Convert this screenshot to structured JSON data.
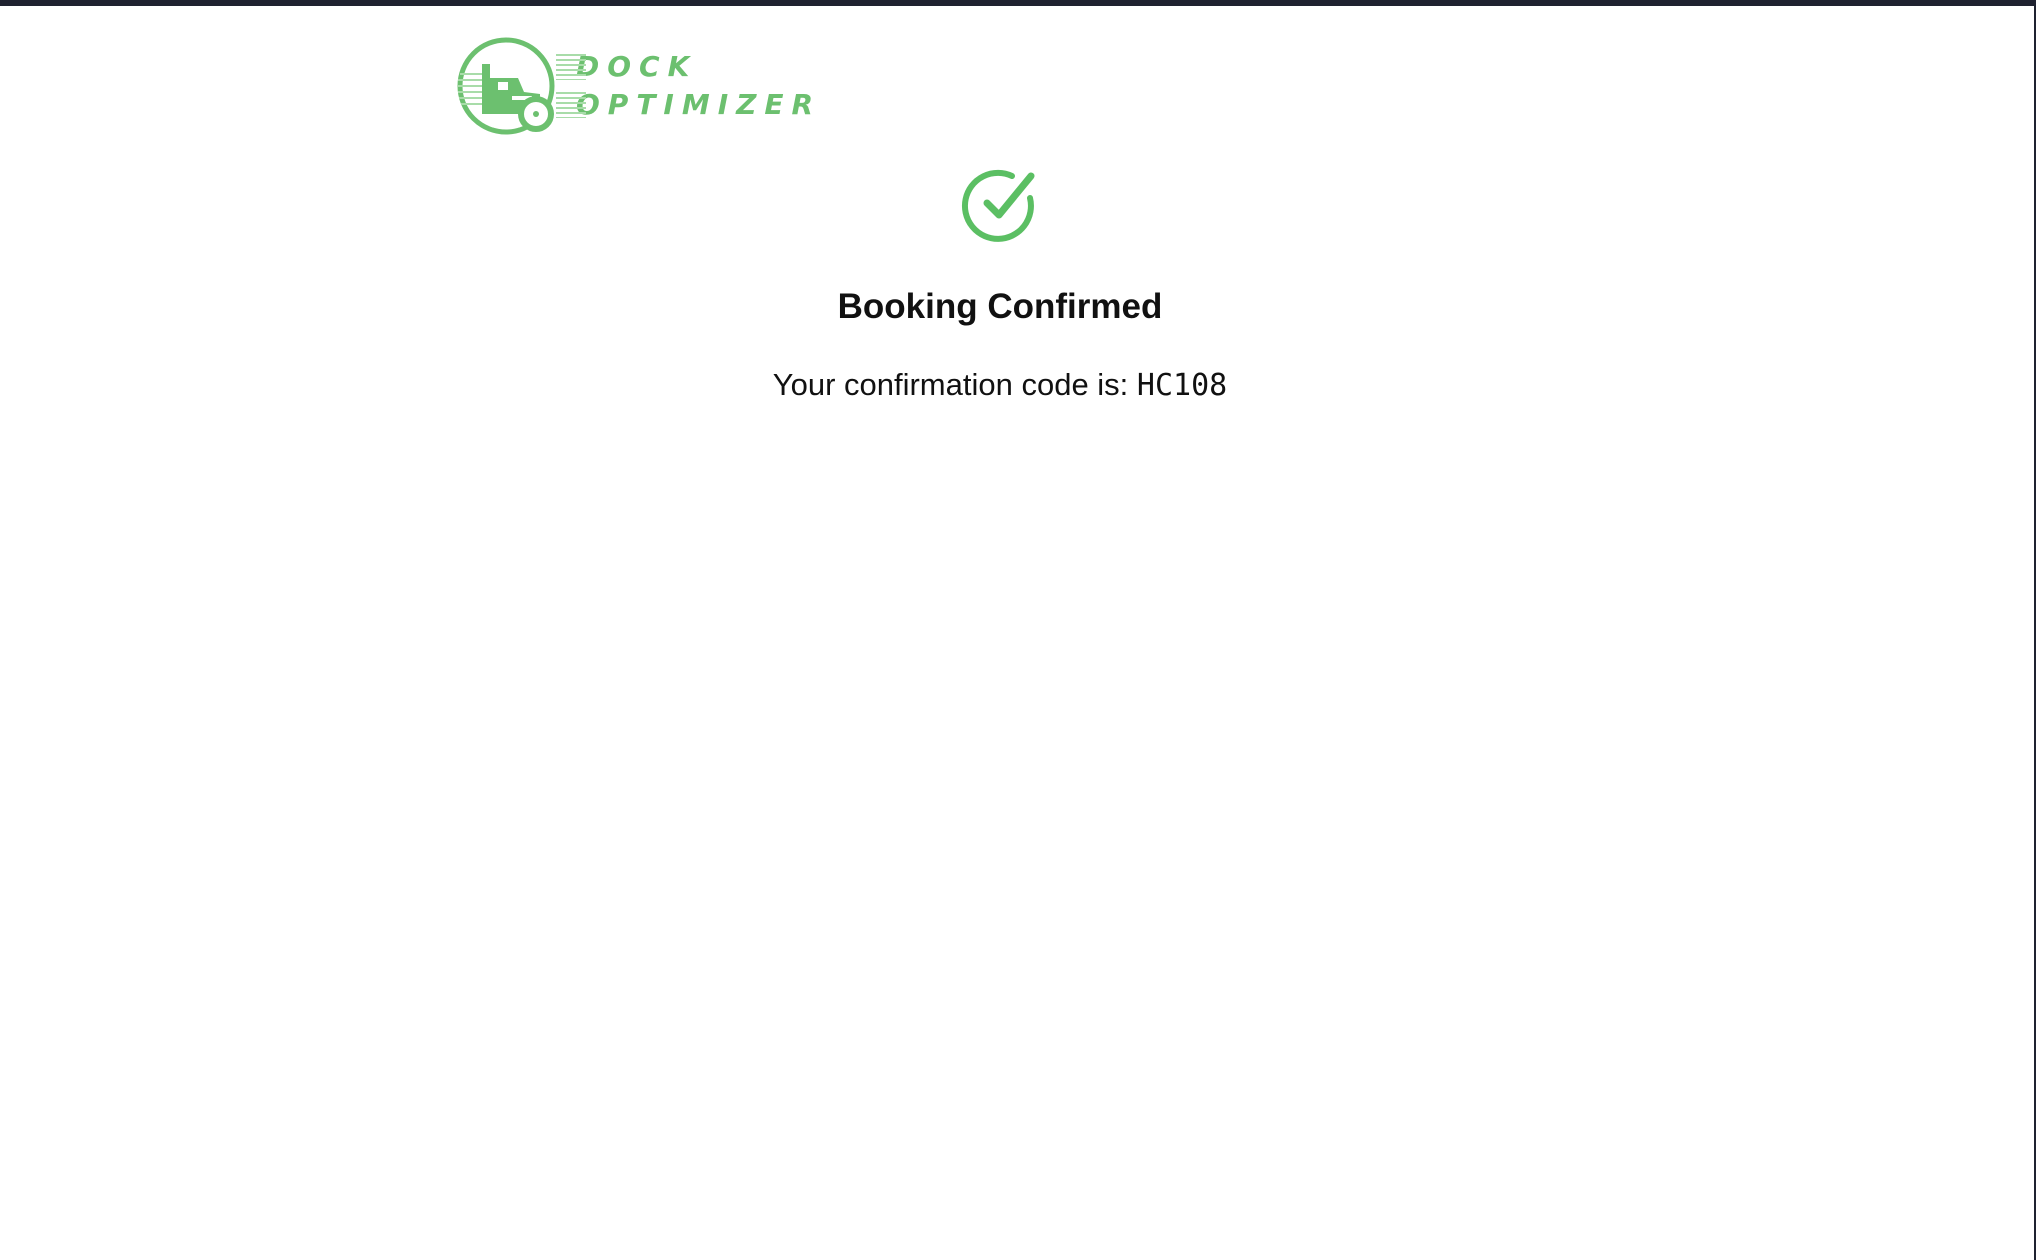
{
  "brand": {
    "logo_line1": "DOCK",
    "logo_line2": "OPTIMIZER",
    "color": "#6cc06f"
  },
  "confirmation": {
    "icon": "check-circle-icon",
    "title": "Booking Confirmed",
    "message_prefix": "Your confirmation code is:",
    "code": "HC108",
    "accent_color": "#5bbf63"
  }
}
